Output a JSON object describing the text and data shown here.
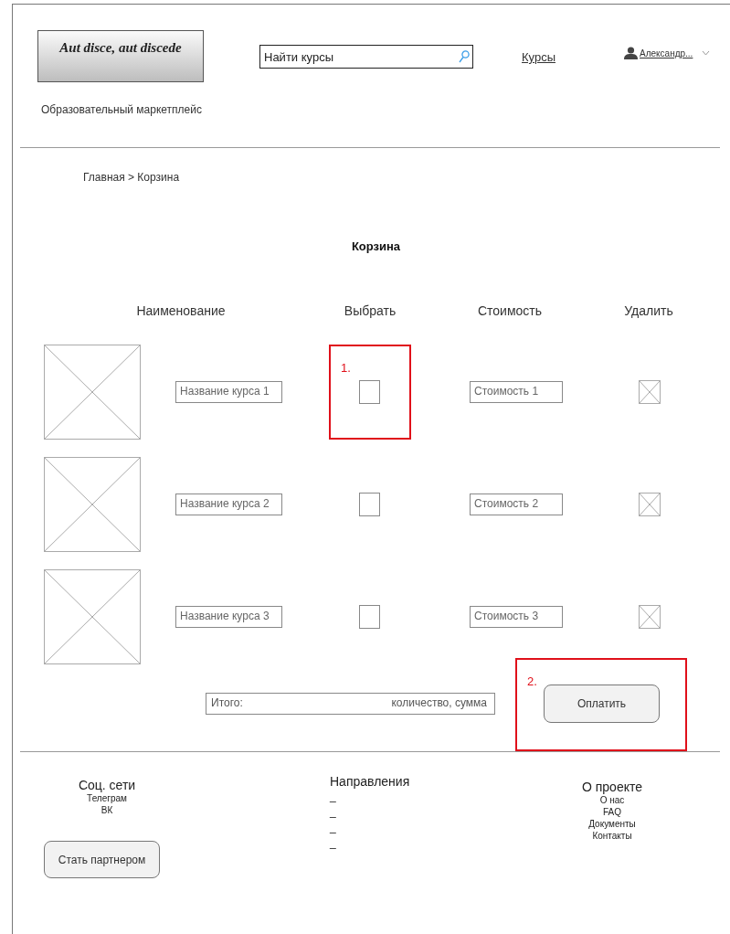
{
  "header": {
    "logo": "Aut disce, aut  discede",
    "tagline": "Образовательный маркетплейс",
    "search": {
      "placeholder": "Найти курсы"
    },
    "nav_link": "Курсы",
    "user": {
      "name": "Александр..."
    }
  },
  "breadcrumb": "Главная > Корзина",
  "title": "Корзина",
  "table": {
    "columns": [
      "Наименование",
      "Выбрать",
      "Стоимость",
      "Удалить"
    ],
    "rows": [
      {
        "name": "Название курса 1",
        "checked": false,
        "cost": "Стоимость 1"
      },
      {
        "name": "Название курса 2",
        "checked": false,
        "cost": "Стоимость 2"
      },
      {
        "name": "Название курса 3",
        "checked": false,
        "cost": "Стоимость 3"
      }
    ]
  },
  "total": {
    "label": "Итого:",
    "value": "количество, сумма"
  },
  "pay_button": "Оплатить",
  "annotations": [
    {
      "label": "1."
    },
    {
      "label": "2."
    }
  ],
  "footer": {
    "social": {
      "title": "Соц. сети",
      "items": [
        "Телеграм",
        "ВК"
      ]
    },
    "directions": {
      "title": "Направления",
      "items": [
        "_",
        "_",
        "_",
        "_"
      ]
    },
    "about": {
      "title": "О проекте",
      "items": [
        "О нас",
        "FAQ",
        "Документы",
        "Контакты"
      ]
    },
    "partner_button": "Стать партнером"
  }
}
